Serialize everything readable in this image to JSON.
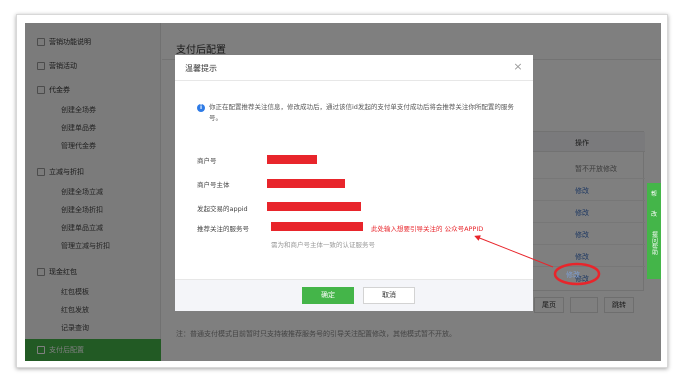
{
  "sidebar": {
    "items": [
      {
        "label": "营销功能说明",
        "type": "section"
      },
      {
        "label": "营销活动",
        "type": "section"
      },
      {
        "label": "代金券",
        "type": "section"
      },
      {
        "label": "创建全场券",
        "type": "sub"
      },
      {
        "label": "创建单品券",
        "type": "sub"
      },
      {
        "label": "管理代金券",
        "type": "sub"
      },
      {
        "label": "立减与折扣",
        "type": "section"
      },
      {
        "label": "创建全场立减",
        "type": "sub"
      },
      {
        "label": "创建全场折扣",
        "type": "sub"
      },
      {
        "label": "创建单品立减",
        "type": "sub"
      },
      {
        "label": "管理立减与折扣",
        "type": "sub"
      },
      {
        "label": "现金红包",
        "type": "section"
      },
      {
        "label": "红包模板",
        "type": "sub"
      },
      {
        "label": "红包发放",
        "type": "sub"
      },
      {
        "label": "记录查询",
        "type": "sub"
      },
      {
        "label": "支付后配置",
        "type": "active"
      }
    ]
  },
  "main": {
    "page_title": "支付后配置",
    "table_header_op": "操作",
    "ops": [
      "暂不开放修改",
      "修改",
      "修改",
      "修改",
      "修改",
      "修改",
      "修改"
    ],
    "pager": {
      "prev": "尾页",
      "jump": "跳转"
    },
    "footnote": "注：普通支付模式目前暂时只支持被推荐服务号的引导关注配置修改，其他模式暂不开放。"
  },
  "tools": [
    "帮",
    "改",
    "提问帮助"
  ],
  "modal": {
    "title": "温馨提示",
    "close": "×",
    "info": "你正在配置推荐关注信息，修改成功后，通过该信id发起的支付单支付成功后将会推荐关注你所配置的服务号。",
    "fields": [
      {
        "label": "商户号"
      },
      {
        "label": "商户号主体"
      },
      {
        "label": "发起交易的appid"
      },
      {
        "label": "推荐关注的服务号"
      }
    ],
    "red_note": "此处输入想要引导关注的 公众号APPID",
    "hint": "需为和商户号主体一致的认证服务号",
    "ok": "确定",
    "cancel": "取消"
  },
  "colors": {
    "brand": "#44b549",
    "redaction": "#e8252b",
    "info": "#2e7be6"
  }
}
